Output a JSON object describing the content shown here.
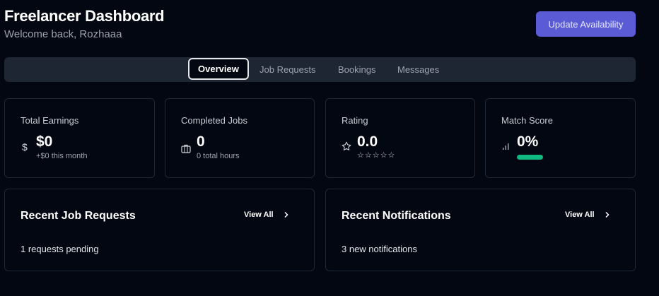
{
  "header": {
    "title": "Freelancer Dashboard",
    "subtitle": "Welcome back, Rozhaaa",
    "update_button": "Update Availability"
  },
  "tabs": [
    {
      "label": "Overview",
      "active": true
    },
    {
      "label": "Job Requests",
      "active": false
    },
    {
      "label": "Bookings",
      "active": false
    },
    {
      "label": "Messages",
      "active": false
    }
  ],
  "stats": {
    "earnings": {
      "label": "Total Earnings",
      "value": "$0",
      "sub": "+$0 this month",
      "icon": "dollar-icon"
    },
    "jobs": {
      "label": "Completed Jobs",
      "value": "0",
      "sub": "0 total hours",
      "icon": "briefcase-icon"
    },
    "rating": {
      "label": "Rating",
      "value": "0.0",
      "stars": "☆☆☆☆☆",
      "icon": "star-icon"
    },
    "match": {
      "label": "Match Score",
      "value": "0%",
      "progress_percent": 100,
      "icon": "signal-icon"
    }
  },
  "panels": {
    "job_requests": {
      "title": "Recent Job Requests",
      "view_all": "View All",
      "body": "1 requests pending"
    },
    "notifications": {
      "title": "Recent Notifications",
      "view_all": "View All",
      "body": "3 new notifications"
    }
  },
  "colors": {
    "accent": "#5b5bd6",
    "success": "#10b981",
    "background": "#030712"
  }
}
